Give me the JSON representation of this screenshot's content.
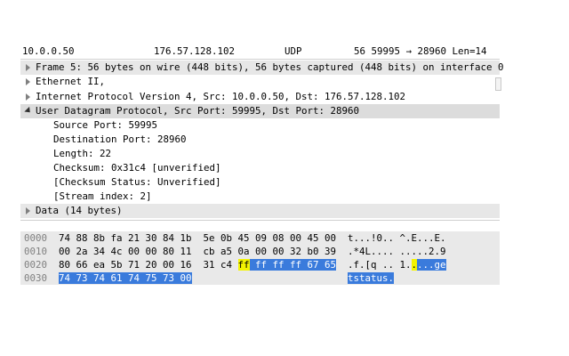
{
  "packet_list": {
    "row": {
      "source": "10.0.0.50",
      "destination": "176.57.128.102",
      "protocol": "UDP",
      "info": "56 59995 → 28960 Len=14"
    }
  },
  "detail": {
    "frame": "Frame 5: 56 bytes on wire (448 bits), 56 bytes captured (448 bits) on interface 0",
    "ethernet": "Ethernet II,",
    "ip": "Internet Protocol Version 4, Src: 10.0.0.50, Dst: 176.57.128.102",
    "udp": "User Datagram Protocol, Src Port: 59995, Dst Port: 28960",
    "udp_fields": {
      "src_port": "Source Port: 59995",
      "dst_port": "Destination Port: 28960",
      "length": "Length: 22",
      "checksum": "Checksum: 0x31c4 [unverified]",
      "checksum_status": "[Checksum Status: Unverified]",
      "stream_index": "[Stream index: 2]"
    },
    "data": "Data (14 bytes)"
  },
  "bytes": {
    "rows": [
      {
        "offset": "0000",
        "hex": "74 88 8b fa 21 30 84 1b  5e 0b 45 09 08 00 45 00",
        "ascii": "t...!0.. ^.E...E."
      },
      {
        "offset": "0010",
        "hex": "00 2a 34 4c 00 00 80 11  cb a5 0a 00 00 32 b0 39",
        "ascii": ".*4L.... .....2.9"
      },
      {
        "offset": "0020",
        "hex_plain": "80 66 ea 5b 71 20 00 16  31 c4 ",
        "hex_cur": "ff",
        "hex_sel": " ff ff ff 67 65",
        "ascii_plain": ".f.[q .. 1.",
        "ascii_cur": ".",
        "ascii_sel": "...ge"
      },
      {
        "offset": "0030",
        "hex_sel": "74 73 74 61 74 75 73 00",
        "ascii_sel": "tstatus."
      }
    ]
  },
  "colors": {
    "selection": "#3a7bdc",
    "cursor_byte": "#f3f300",
    "udp_row": "#dcdcdc",
    "bytes_bg": "#e9e9e9"
  }
}
